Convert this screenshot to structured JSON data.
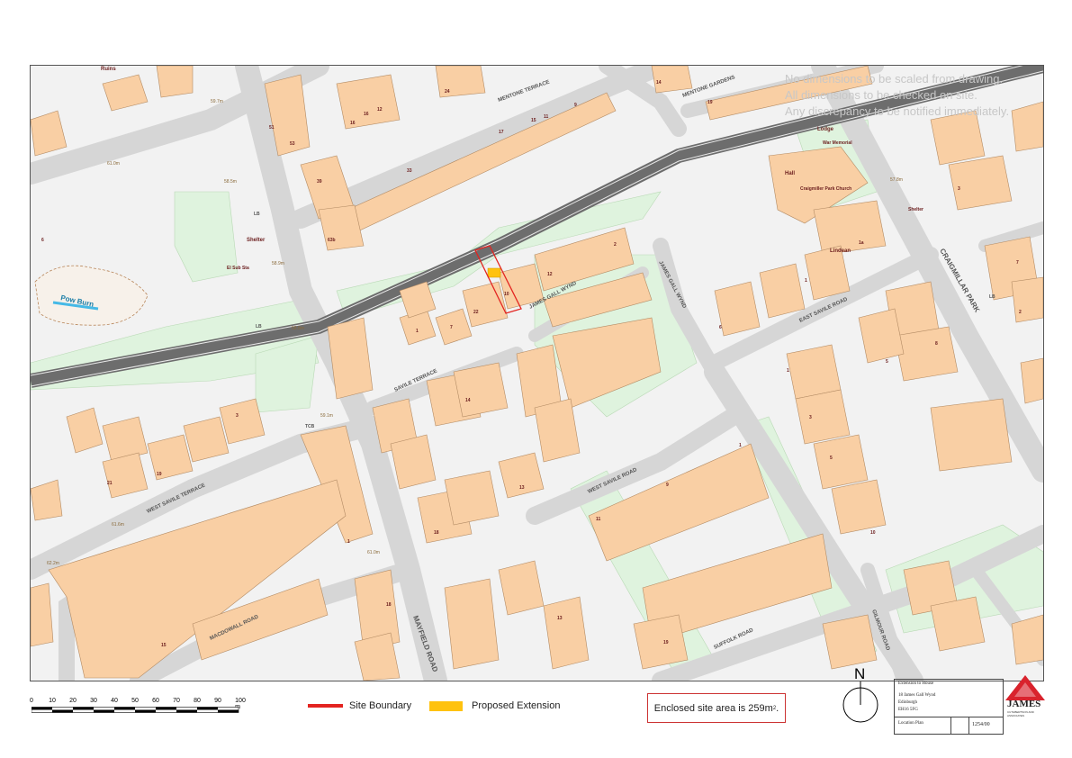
{
  "notes": {
    "line1": "No dimensions to be scaled from drawing.",
    "line2": "All dimensions to be checked on site.",
    "line3": "Any discrepancy to be notified immediately."
  },
  "map": {
    "streets": [
      {
        "id": "mentone_terrace",
        "text": "MENTONE TERRACE"
      },
      {
        "id": "mentone_gardens",
        "text": "MENTONE GARDENS"
      },
      {
        "id": "craigmillar_park",
        "text": "CRAIGMILLAR PARK"
      },
      {
        "id": "east_savile_road",
        "text": "EAST SAVILE ROAD"
      },
      {
        "id": "james_gall_wynd_1",
        "text": "JAMES GALL WYND"
      },
      {
        "id": "james_gall_wynd_2",
        "text": "JAMES GALL WYND"
      },
      {
        "id": "savile_terrace",
        "text": "SAVILE TERRACE"
      },
      {
        "id": "west_savile_terrace",
        "text": "WEST SAVILE TERRACE"
      },
      {
        "id": "west_savile_road",
        "text": "WEST SAVILE ROAD"
      },
      {
        "id": "mayfield_road",
        "text": "MAYFIELD ROAD"
      },
      {
        "id": "macdowall_road",
        "text": "MACDOWALL ROAD"
      },
      {
        "id": "suffolk_road",
        "text": "SUFFOLK ROAD"
      },
      {
        "id": "gilmour_road",
        "text": "GILMOUR ROAD"
      }
    ],
    "places": [
      {
        "id": "ruins",
        "text": "Ruins"
      },
      {
        "id": "pow_burn",
        "text": "Pow Burn"
      },
      {
        "id": "shelter_1",
        "text": "Shelter"
      },
      {
        "id": "el_sub_sta",
        "text": "El Sub Sta"
      },
      {
        "id": "lodge",
        "text": "Lodge"
      },
      {
        "id": "war_memorial",
        "text": "War Memorial"
      },
      {
        "id": "hall",
        "text": "Hall"
      },
      {
        "id": "church",
        "text": "Craigmiller Park Church"
      },
      {
        "id": "lindean",
        "text": "Lindean"
      },
      {
        "id": "shelter_2",
        "text": "Shelter"
      },
      {
        "id": "tcb",
        "text": "TCB"
      },
      {
        "id": "lb_1",
        "text": "LB"
      },
      {
        "id": "lb_2",
        "text": "LB"
      },
      {
        "id": "lb_3",
        "text": "LB"
      }
    ],
    "spot_heights": [
      {
        "id": "h1",
        "text": "59.7m"
      },
      {
        "id": "h2",
        "text": "61.0m"
      },
      {
        "id": "h3",
        "text": "58.5m"
      },
      {
        "id": "h4",
        "text": "58.9m"
      },
      {
        "id": "h5",
        "text": "58.8m"
      },
      {
        "id": "h6",
        "text": "57.8m"
      },
      {
        "id": "h7",
        "text": "59.1m"
      },
      {
        "id": "h8",
        "text": "61.6m"
      },
      {
        "id": "h9",
        "text": "62.2m"
      },
      {
        "id": "h10",
        "text": "61.0m"
      }
    ],
    "house_numbers": [
      {
        "id": "n1",
        "text": "10"
      },
      {
        "id": "n2",
        "text": "22"
      },
      {
        "id": "n3",
        "text": "12"
      },
      {
        "id": "n4",
        "text": "2"
      },
      {
        "id": "n5",
        "text": "7"
      },
      {
        "id": "n6",
        "text": "1"
      },
      {
        "id": "n7",
        "text": "14"
      },
      {
        "id": "n8",
        "text": "13"
      },
      {
        "id": "n9",
        "text": "18"
      },
      {
        "id": "n10",
        "text": "9"
      },
      {
        "id": "n11",
        "text": "11"
      },
      {
        "id": "n12",
        "text": "1"
      },
      {
        "id": "n13",
        "text": "19"
      },
      {
        "id": "n14",
        "text": "21"
      },
      {
        "id": "n15",
        "text": "5"
      },
      {
        "id": "n16",
        "text": "3"
      },
      {
        "id": "n17",
        "text": "1"
      },
      {
        "id": "n18",
        "text": "63b"
      },
      {
        "id": "n19",
        "text": "6"
      },
      {
        "id": "n20",
        "text": "1"
      },
      {
        "id": "n21",
        "text": "3"
      },
      {
        "id": "n22",
        "text": "19"
      },
      {
        "id": "n23",
        "text": "15"
      },
      {
        "id": "n24",
        "text": "11"
      },
      {
        "id": "n25",
        "text": "9"
      },
      {
        "id": "n26",
        "text": "17"
      },
      {
        "id": "n27",
        "text": "33"
      },
      {
        "id": "n28",
        "text": "24"
      },
      {
        "id": "n29",
        "text": "14"
      },
      {
        "id": "n30",
        "text": "16"
      },
      {
        "id": "n31",
        "text": "12"
      },
      {
        "id": "n32",
        "text": "1a"
      },
      {
        "id": "n33",
        "text": "8"
      },
      {
        "id": "n34",
        "text": "10"
      },
      {
        "id": "n35",
        "text": "5"
      },
      {
        "id": "n36",
        "text": "6"
      },
      {
        "id": "n37",
        "text": "3"
      },
      {
        "id": "n38",
        "text": "1"
      },
      {
        "id": "n39",
        "text": "2"
      },
      {
        "id": "n40",
        "text": "7"
      },
      {
        "id": "n41",
        "text": "19"
      },
      {
        "id": "n42",
        "text": "13"
      },
      {
        "id": "n43",
        "text": "15"
      },
      {
        "id": "n44",
        "text": "51"
      },
      {
        "id": "n45",
        "text": "53"
      },
      {
        "id": "n46",
        "text": "18"
      },
      {
        "id": "n47",
        "text": "16"
      },
      {
        "id": "n48",
        "text": "39"
      }
    ]
  },
  "scale_bar": {
    "ticks": [
      "0",
      "10",
      "20",
      "30",
      "40",
      "50",
      "60",
      "70",
      "80",
      "90",
      "100 m"
    ]
  },
  "legend": {
    "site_boundary": {
      "label": "Site Boundary",
      "color": "#e32420"
    },
    "proposed_extension": {
      "label": "Proposed Extension",
      "color": "#ffc20e"
    }
  },
  "site_area": {
    "text": "Enclosed site  area is 259m",
    "sup": "2",
    "suffix": "."
  },
  "north": {
    "label": "N"
  },
  "title_block": {
    "line1": "Extension to House",
    "line2": "18 James Gall Wynd",
    "line3": "Edinburgh",
    "line4": "EH16 5FG",
    "drawing": "Location Plan",
    "number": "1254/00"
  },
  "logo": {
    "name": "JAMES",
    "sub": "CUTHBERTSON AND ASSOCIATES",
    "color": "#d9232d"
  },
  "colors": {
    "building": "#f9cfa4",
    "road": "#dcdcdc",
    "green": "#dff3de",
    "railway": "#5f5f5f",
    "water": "#46b9e6"
  }
}
